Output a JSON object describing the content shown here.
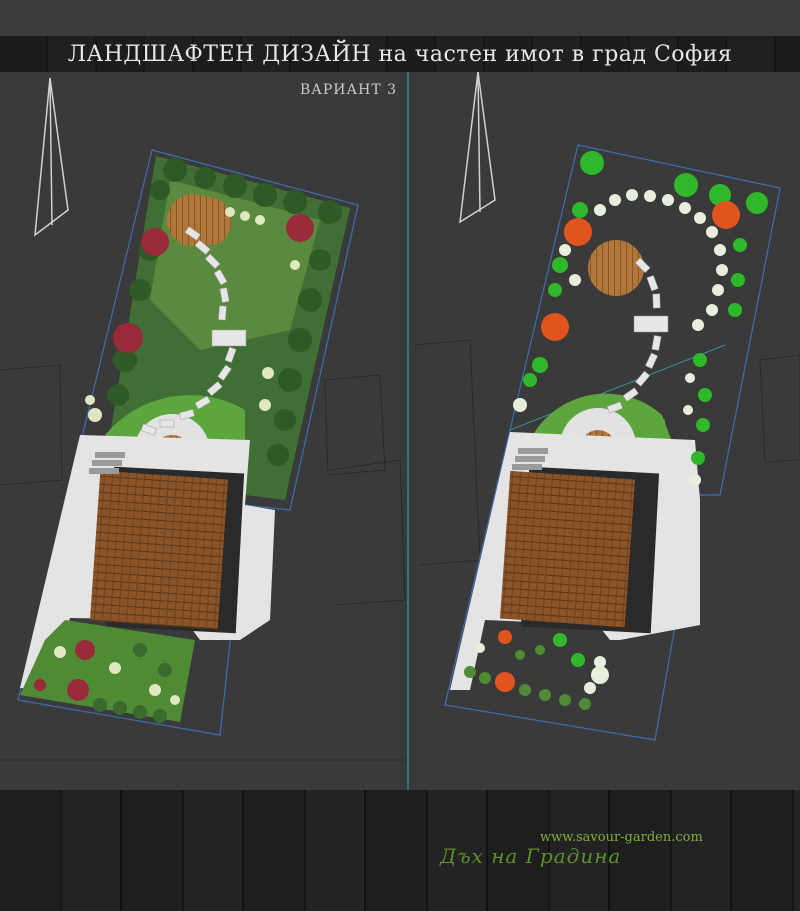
{
  "header": {
    "title": "ЛАНДШАФТЕН ДИЗАЙН на частен имот в град София",
    "variant": "ВАРИАНТ 3"
  },
  "footer": {
    "url": "www.savour-garden.com",
    "brand": "Дъх на Градина"
  },
  "colors": {
    "background": "#3a3a3a",
    "wood_bar": "#1c1c1c",
    "lawn": "#5a9a3a",
    "roof": "#8a5428",
    "paving": "#e6e6e6",
    "brand_green": "#6fa034",
    "guide_line": "#3aa6b8"
  }
}
